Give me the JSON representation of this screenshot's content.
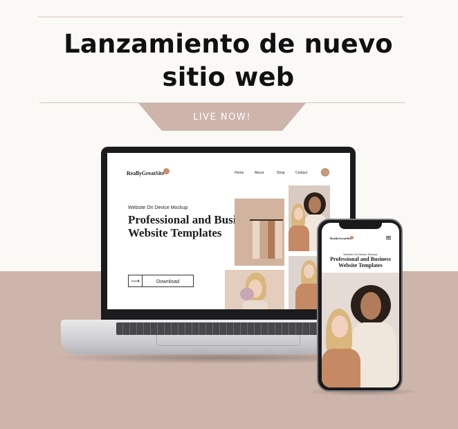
{
  "headline": "Lanzamiento de nuevo sitio web",
  "tag": "LIVE NOW!",
  "laptop_site": {
    "logo": "ReallyGreatSite",
    "nav": [
      "Home",
      "About",
      "Shop",
      "Contact"
    ],
    "subtitle": "Website On Device Mockup",
    "title": "Professional and Business Website Templates",
    "button_label": "Download",
    "button_icon": "arrow-right-icon"
  },
  "phone_site": {
    "logo": "ReallyGreatSite",
    "subtitle": "Website On Device Mockup",
    "title": "Professional and Business Website Templates"
  },
  "colors": {
    "background": "#fbf9f5",
    "accent_band": "#cdb5ab",
    "tag_text": "#ffffff",
    "headline_text": "#111111"
  }
}
